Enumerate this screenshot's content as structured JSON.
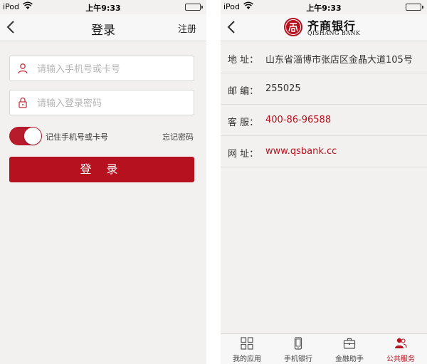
{
  "colors": {
    "brand": "#b5111f",
    "battery": "#3cc43c"
  },
  "status_bar": {
    "carrier": "iPod",
    "time": "上午9:33"
  },
  "login_screen": {
    "title": "登录",
    "register_label": "注册",
    "phone_placeholder": "请输入手机号或卡号",
    "password_placeholder": "请输入登录密码",
    "remember_label": "记住手机号或卡号",
    "remember_on": true,
    "forgot_label": "忘记密码",
    "login_button": "登 录"
  },
  "info_screen": {
    "logo": {
      "cn": "齐商银行",
      "en": "QISHANG BANK"
    },
    "rows": [
      {
        "key": "地  址：",
        "value": "山东省淄博市张店区金晶大道105号"
      },
      {
        "key": "邮  编：",
        "value": "255025"
      },
      {
        "key": "客  服：",
        "value": "400-86-96588"
      },
      {
        "key": "网  址：",
        "value": "www.qsbank.cc"
      }
    ],
    "tabs": [
      {
        "label": "我的应用",
        "icon": "grid-icon"
      },
      {
        "label": "手机银行",
        "icon": "phone-icon"
      },
      {
        "label": "金融助手",
        "icon": "briefcase-icon"
      },
      {
        "label": "公共服务",
        "icon": "people-icon",
        "active": true
      }
    ]
  }
}
